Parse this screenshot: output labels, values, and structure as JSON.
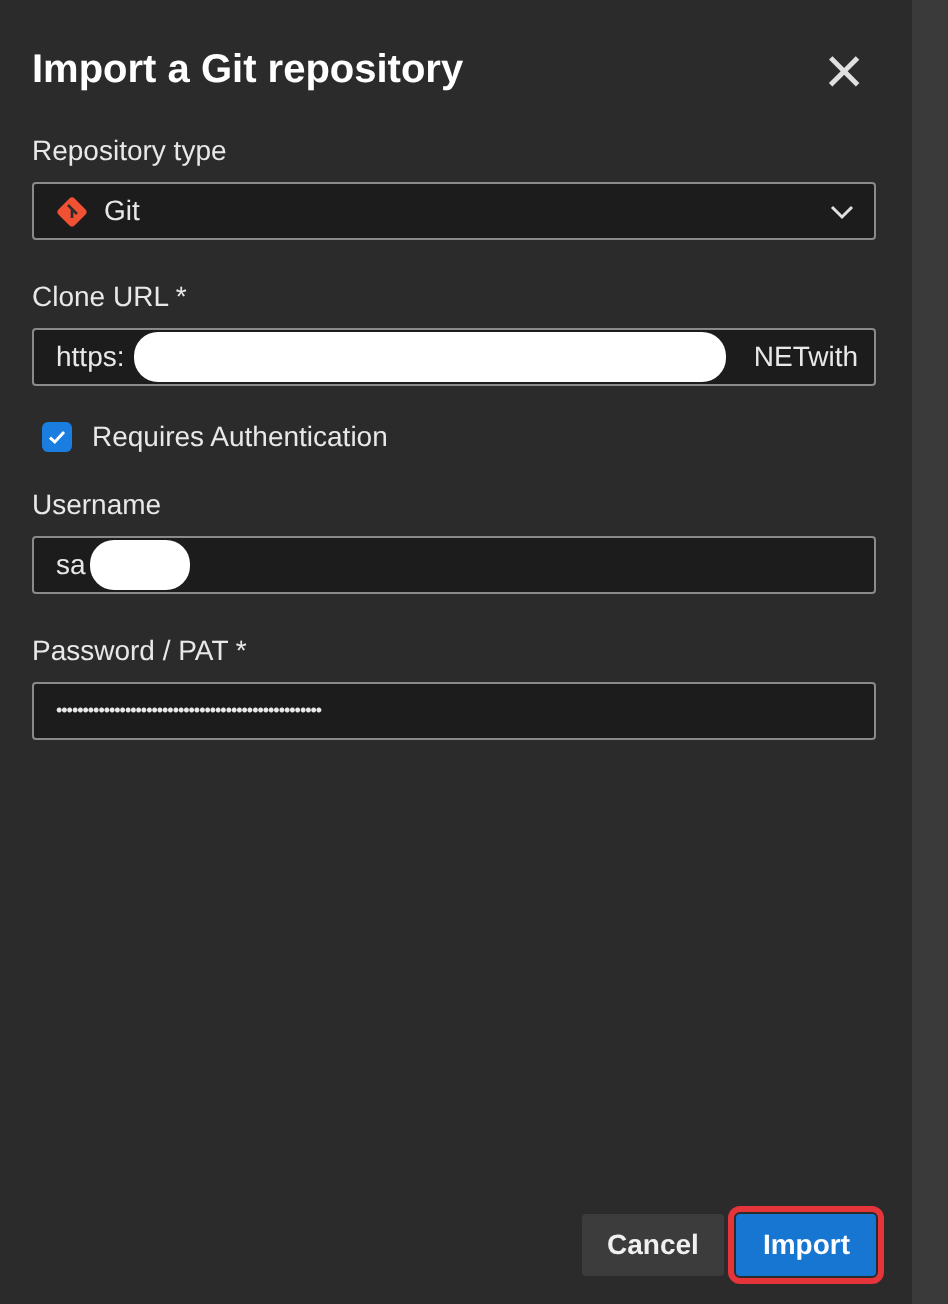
{
  "dialog": {
    "title": "Import a Git repository",
    "close": "×"
  },
  "fields": [
    {
      "kind": "dropdown",
      "label": "Repository type",
      "value": "Git"
    },
    {
      "kind": "text",
      "label": "Clone URL *",
      "value_start": "https:",
      "value_end": "NETwith",
      "redacted": true
    },
    {
      "kind": "checkbox",
      "label": "Requires Authentication",
      "checked": true
    },
    {
      "kind": "text",
      "label": "Username",
      "value_start": "sa",
      "redacted": true
    },
    {
      "kind": "password",
      "label": "Password / PAT *",
      "value": "••••••••••••••••••••••••••••••••••••••••••••••••••"
    }
  ],
  "buttons": [
    {
      "label": "Cancel",
      "kind": "secondary",
      "highlighted": false
    },
    {
      "label": "Import",
      "kind": "primary",
      "highlighted": true
    }
  ]
}
